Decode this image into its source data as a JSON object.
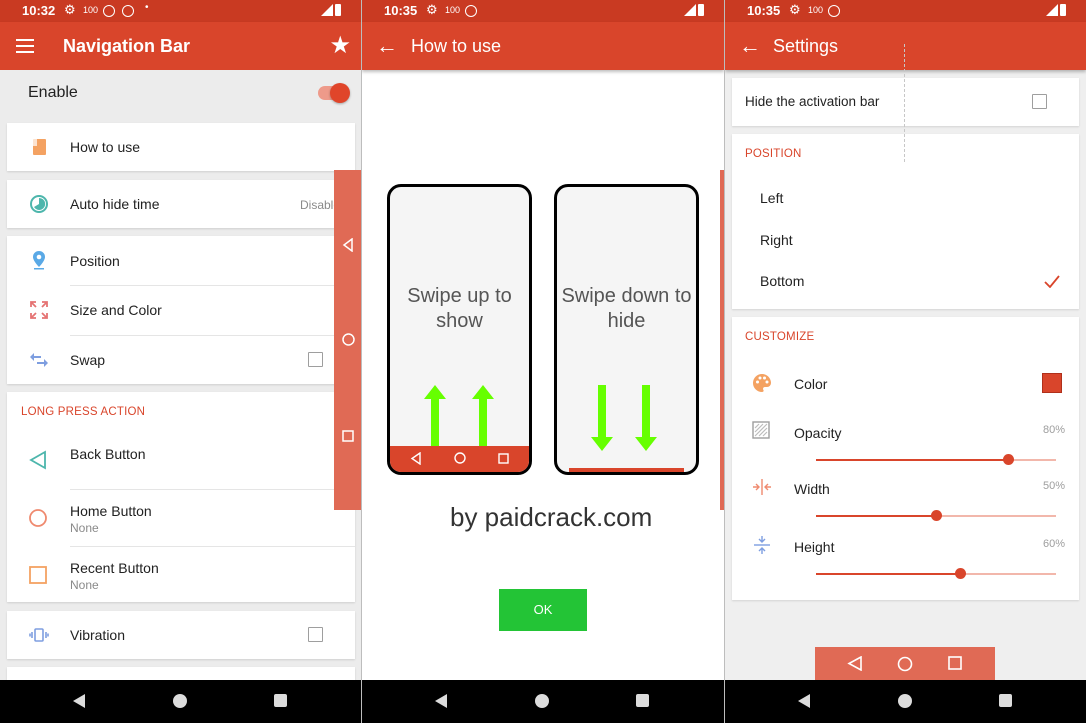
{
  "status": {
    "p1_time": "10:32",
    "p2_time": "10:35",
    "p3_time": "10:35",
    "battery_label": "100"
  },
  "panel1": {
    "title": "Navigation Bar",
    "enable_label": "Enable",
    "items": {
      "how_to_use": "How to use",
      "auto_hide": "Auto hide time",
      "auto_hide_value": "Disable",
      "position": "Position",
      "size_color": "Size and Color",
      "swap": "Swap"
    },
    "long_press_header": "LONG PRESS ACTION",
    "back_button": "Back Button",
    "home_button": "Home Button",
    "home_value": "None",
    "recent_button": "Recent Button",
    "recent_value": "None",
    "vibration": "Vibration"
  },
  "panel2": {
    "title": "How to use",
    "phone1_text": "Swipe up to show",
    "phone2_text": "Swipe down to hide",
    "watermark": "by paidcrack.com",
    "ok_label": "OK"
  },
  "panel3": {
    "title": "Settings",
    "hide_activation": "Hide the activation bar",
    "position_header": "POSITION",
    "positions": [
      "Left",
      "Right",
      "Bottom"
    ],
    "selected_position": "Bottom",
    "customize_header": "CUSTOMIZE",
    "color_label": "Color",
    "opacity_label": "Opacity",
    "opacity_pct": "80%",
    "opacity_value": 0.8,
    "width_label": "Width",
    "width_pct": "50%",
    "width_value": 0.5,
    "height_label": "Height",
    "height_pct": "60%",
    "height_value": 0.6
  },
  "colors": {
    "primary": "#d9452b",
    "status": "#c93a22",
    "ok_green": "#23c436",
    "arrow_green": "#66ff00",
    "floating_bar": "#e06a55"
  },
  "icons": {
    "menu": "menu-icon",
    "star": "star-icon",
    "back_arrow": "arrow-back-icon"
  }
}
